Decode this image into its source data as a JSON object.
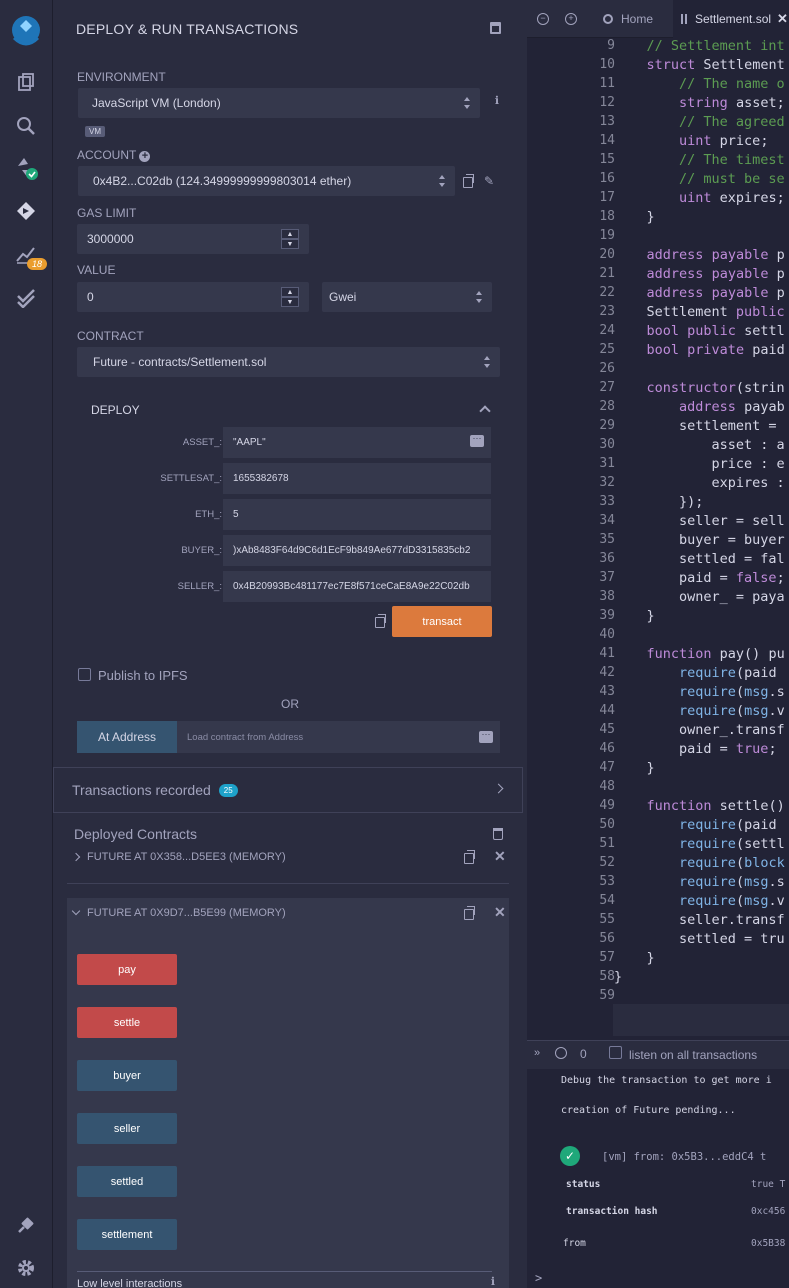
{
  "app": {
    "title": "DEPLOY & RUN TRANSACTIONS"
  },
  "iconbar": {
    "plugin_badge": "18"
  },
  "environment": {
    "label": "ENVIRONMENT",
    "value": "JavaScript VM (London)",
    "badge": "VM"
  },
  "account": {
    "label": "ACCOUNT",
    "value": "0x4B2...C02db (124.34999999999803014 ether)"
  },
  "gas": {
    "label": "GAS LIMIT",
    "value": "3000000"
  },
  "value": {
    "label": "VALUE",
    "amount": "0",
    "unit": "Gwei"
  },
  "contract": {
    "label": "CONTRACT",
    "value": "Future - contracts/Settlement.sol"
  },
  "deploy": {
    "title": "DEPLOY",
    "params": [
      {
        "label": "ASSET_:",
        "value": "\"AAPL\""
      },
      {
        "label": "SETTLESAT_:",
        "value": "1655382678"
      },
      {
        "label": "ETH_:",
        "value": "5"
      },
      {
        "label": "BUYER_:",
        "value": ")xAb8483F64d9C6d1EcF9b849Ae677dD3315835cb2"
      },
      {
        "label": "SELLER_:",
        "value": "0x4B20993Bc481177ec7E8f571ceCaE8A9e22C02db"
      }
    ],
    "transact": "transact"
  },
  "publish": {
    "label": "Publish to IPFS"
  },
  "or_label": "OR",
  "at_address": {
    "button": "At Address",
    "placeholder": "Load contract from Address"
  },
  "transactions": {
    "label": "Transactions recorded",
    "count": "25"
  },
  "deployed": {
    "title": "Deployed Contracts",
    "instances": [
      {
        "label": "FUTURE AT 0X358...D5EE3 (MEMORY)"
      },
      {
        "label": "FUTURE AT 0X9D7...B5E99 (MEMORY)"
      }
    ],
    "functions": [
      "pay",
      "settle",
      "buyer",
      "seller",
      "settled",
      "settlement"
    ],
    "low_level": "Low level interactions"
  },
  "editor": {
    "tabs": {
      "home": "Home",
      "file": "Settlement.sol"
    },
    "lines": [
      {
        "n": "9",
        "code": "    // Settlement int"
      },
      {
        "n": "10",
        "code": "    struct Settlement"
      },
      {
        "n": "11",
        "code": "        // The name o"
      },
      {
        "n": "12",
        "code": "        string asset;"
      },
      {
        "n": "13",
        "code": "        // The agreed"
      },
      {
        "n": "14",
        "code": "        uint price;"
      },
      {
        "n": "15",
        "code": "        // The timest"
      },
      {
        "n": "16",
        "code": "        // must be se"
      },
      {
        "n": "17",
        "code": "        uint expires;"
      },
      {
        "n": "18",
        "code": "    }"
      },
      {
        "n": "19",
        "code": ""
      },
      {
        "n": "20",
        "code": "    address payable p"
      },
      {
        "n": "21",
        "code": "    address payable p"
      },
      {
        "n": "22",
        "code": "    address payable p"
      },
      {
        "n": "23",
        "code": "    Settlement public"
      },
      {
        "n": "24",
        "code": "    bool public settl"
      },
      {
        "n": "25",
        "code": "    bool private paid"
      },
      {
        "n": "26",
        "code": ""
      },
      {
        "n": "27",
        "code": "    constructor(strin"
      },
      {
        "n": "28",
        "code": "        address payab"
      },
      {
        "n": "29",
        "code": "        settlement = "
      },
      {
        "n": "30",
        "code": "            asset : a"
      },
      {
        "n": "31",
        "code": "            price : e"
      },
      {
        "n": "32",
        "code": "            expires :"
      },
      {
        "n": "33",
        "code": "        });"
      },
      {
        "n": "34",
        "code": "        seller = sell"
      },
      {
        "n": "35",
        "code": "        buyer = buyer"
      },
      {
        "n": "36",
        "code": "        settled = fal"
      },
      {
        "n": "37",
        "code": "        paid = false;"
      },
      {
        "n": "38",
        "code": "        owner_ = paya"
      },
      {
        "n": "39",
        "code": "    }"
      },
      {
        "n": "40",
        "code": ""
      },
      {
        "n": "41",
        "code": "    function pay() pu"
      },
      {
        "n": "42",
        "code": "        require(paid "
      },
      {
        "n": "43",
        "code": "        require(msg.s"
      },
      {
        "n": "44",
        "code": "        require(msg.v"
      },
      {
        "n": "45",
        "code": "        owner_.transf"
      },
      {
        "n": "46",
        "code": "        paid = true;"
      },
      {
        "n": "47",
        "code": "    }"
      },
      {
        "n": "48",
        "code": ""
      },
      {
        "n": "49",
        "code": "    function settle()"
      },
      {
        "n": "50",
        "code": "        require(paid "
      },
      {
        "n": "51",
        "code": "        require(settl"
      },
      {
        "n": "52",
        "code": "        require(block"
      },
      {
        "n": "53",
        "code": "        require(msg.s"
      },
      {
        "n": "54",
        "code": "        require(msg.v"
      },
      {
        "n": "55",
        "code": "        seller.transf"
      },
      {
        "n": "56",
        "code": "        settled = tru"
      },
      {
        "n": "57",
        "code": "    }"
      },
      {
        "n": "58",
        "code": "}"
      },
      {
        "n": "59",
        "code": ""
      }
    ]
  },
  "terminal": {
    "count": "0",
    "listen_label": "listen on all transactions",
    "debug_line": "Debug the transaction to get more i",
    "pending_line": "creation of Future pending...",
    "vm_line": "[vm] from: 0x5B3...eddC4 t",
    "rows": [
      {
        "key": "status",
        "value": "true T"
      },
      {
        "key": "transaction hash",
        "value": "0xc456"
      },
      {
        "key": "from",
        "value": "0x5B38"
      }
    ],
    "prompt": ">"
  }
}
